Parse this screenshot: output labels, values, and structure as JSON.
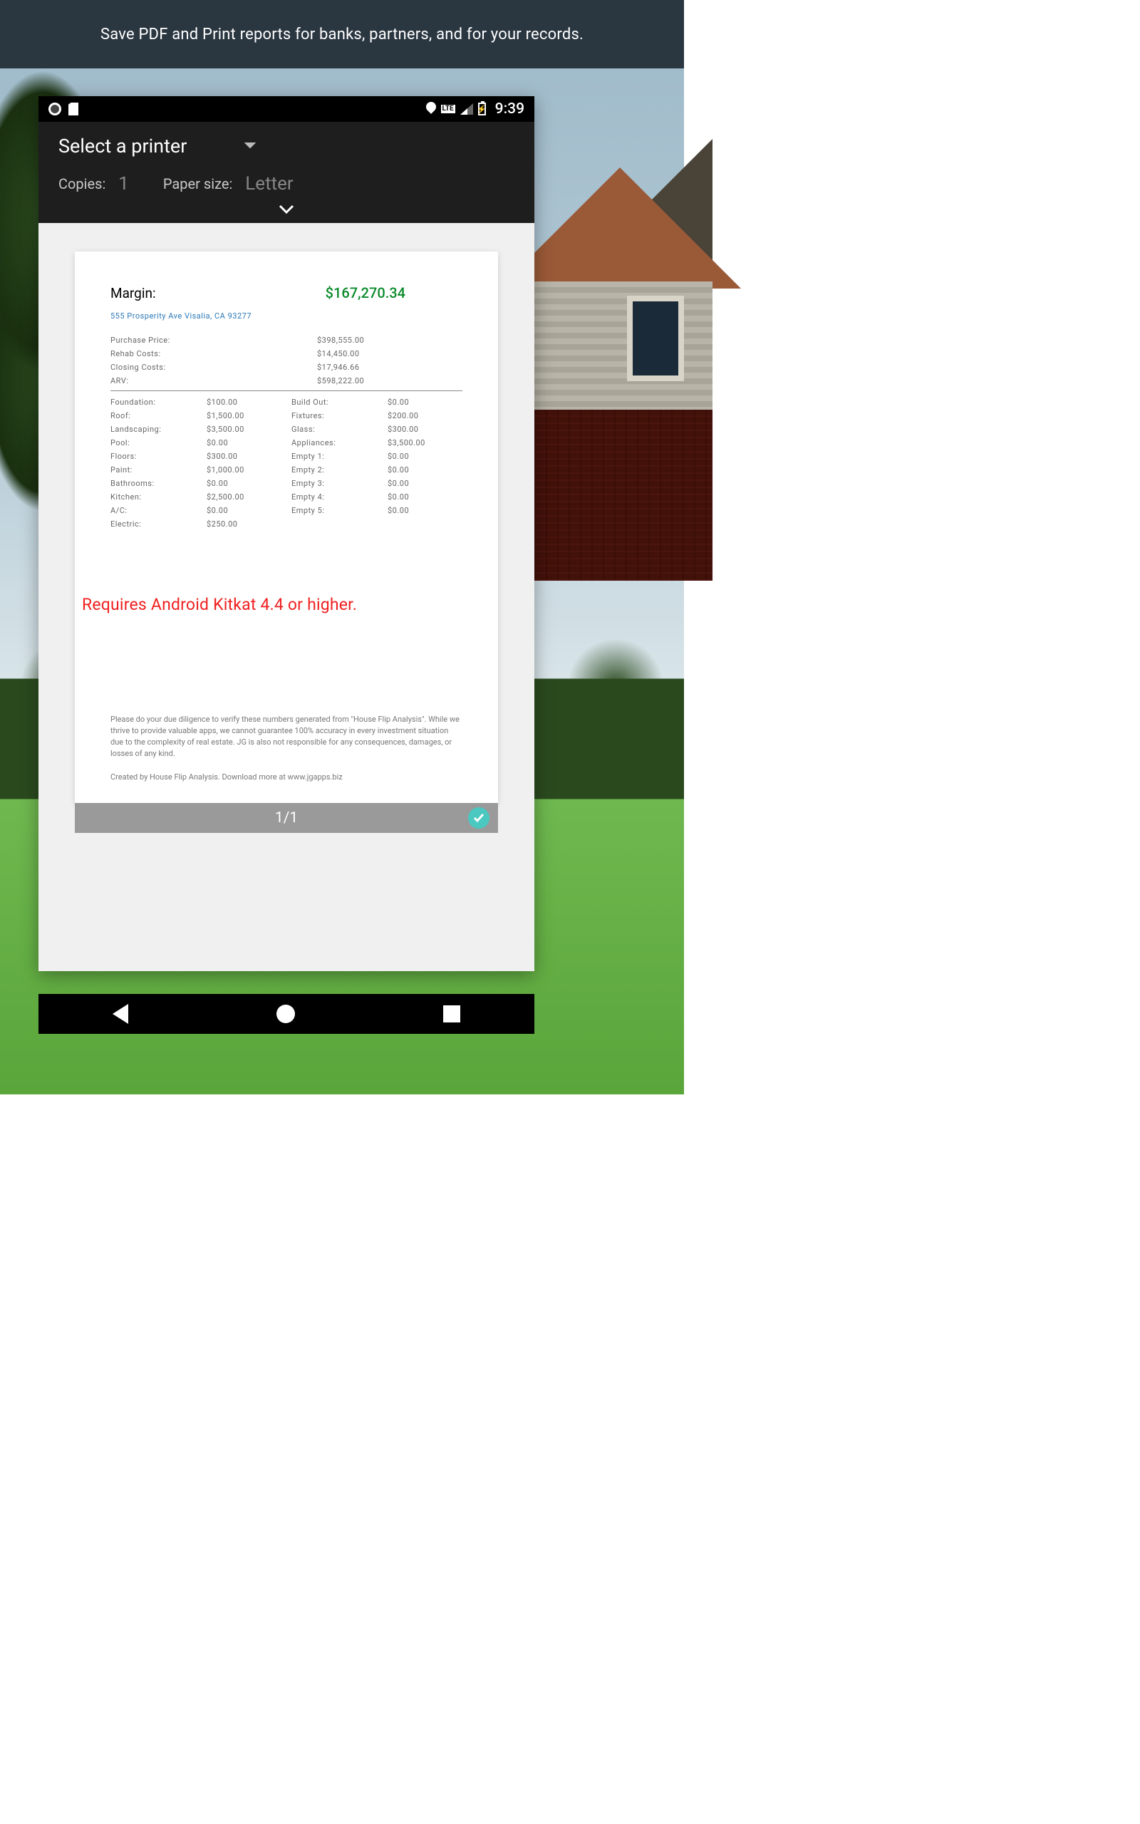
{
  "banner": "Save PDF and Print reports for banks, partners, and for your records.",
  "status": {
    "time": "9:39",
    "network": "LTE"
  },
  "print": {
    "select_label": "Select a printer",
    "copies_label": "Copies:",
    "copies_value": "1",
    "paper_label": "Paper size:",
    "paper_value": "Letter"
  },
  "report": {
    "margin_label": "Margin:",
    "margin_value": "$167,270.34",
    "address": "555 Prosperity Ave Visalia, CA 93277",
    "summary": [
      {
        "k": "Purchase Price:",
        "v": "$398,555.00"
      },
      {
        "k": "Rehab Costs:",
        "v": "$14,450.00"
      },
      {
        "k": "Closing Costs:",
        "v": "$17,946.66"
      },
      {
        "k": "ARV:",
        "v": "$598,222.00"
      }
    ],
    "left": [
      {
        "k": "Foundation:",
        "v": "$100.00"
      },
      {
        "k": "Roof:",
        "v": "$1,500.00"
      },
      {
        "k": "Landscaping:",
        "v": "$3,500.00"
      },
      {
        "k": "Pool:",
        "v": "$0.00"
      },
      {
        "k": "Floors:",
        "v": "$300.00"
      },
      {
        "k": "Paint:",
        "v": "$1,000.00"
      },
      {
        "k": "Bathrooms:",
        "v": "$0.00"
      },
      {
        "k": "Kitchen:",
        "v": "$2,500.00"
      },
      {
        "k": "A/C:",
        "v": "$0.00"
      },
      {
        "k": "Electric:",
        "v": "$250.00"
      }
    ],
    "right": [
      {
        "k": "Build Out:",
        "v": "$0.00"
      },
      {
        "k": "Fixtures:",
        "v": "$200.00"
      },
      {
        "k": "Glass:",
        "v": "$300.00"
      },
      {
        "k": "Appliances:",
        "v": "$3,500.00"
      },
      {
        "k": "Empty 1:",
        "v": "$0.00"
      },
      {
        "k": "Empty 2:",
        "v": "$0.00"
      },
      {
        "k": "Empty 3:",
        "v": "$0.00"
      },
      {
        "k": "Empty 4:",
        "v": "$0.00"
      },
      {
        "k": "Empty 5:",
        "v": "$0.00"
      }
    ],
    "requires": "Requires Android Kitkat 4.4 or higher.",
    "disclaimer": "Please do your due diligence to verify these numbers generated from \"House Flip Analysis\". While we thrive to provide valuable apps, we cannot guarantee 100% accuracy in every investment situation due to the complexity of real estate. JG is also not responsible for any consequences, damages, or losses of any kind.",
    "credit": "Created by House Flip Analysis. Download more at www.jgapps.biz"
  },
  "pager": "1/1"
}
